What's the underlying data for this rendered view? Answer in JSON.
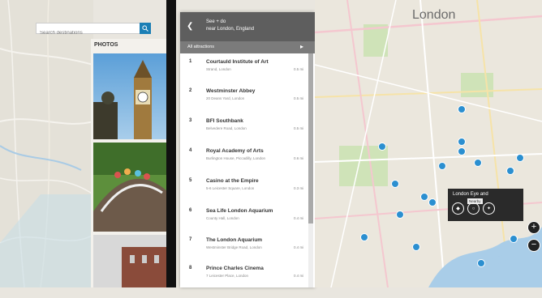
{
  "search": {
    "placeholder": "Search destinations"
  },
  "photos": {
    "label": "PHOTOS"
  },
  "panel": {
    "title": "See + do",
    "subtitle": "near London, England",
    "filter": "All attractions",
    "items": [
      {
        "num": "1",
        "name": "Courtauld Institute of Art",
        "addr": "Strand, London",
        "dist": "0.5 mi"
      },
      {
        "num": "2",
        "name": "Westminster Abbey",
        "addr": "20 Deans Yard, London",
        "dist": "0.5 mi"
      },
      {
        "num": "3",
        "name": "BFI Southbank",
        "addr": "Belvedere Road, London",
        "dist": "0.5 mi"
      },
      {
        "num": "4",
        "name": "Royal Academy of Arts",
        "addr": "Burlington House, Piccadilly, London",
        "dist": "0.6 mi"
      },
      {
        "num": "5",
        "name": "Casino at the Empire",
        "addr": "5-6 Leicester Square, London",
        "dist": "0.3 mi"
      },
      {
        "num": "6",
        "name": "Sea Life London Aquarium",
        "addr": "County Hall, London",
        "dist": "0.4 mi"
      },
      {
        "num": "7",
        "name": "The London Aquarium",
        "addr": "Westminster Bridge Road, London",
        "dist": "0.4 mi"
      },
      {
        "num": "8",
        "name": "Prince Charles Cinema",
        "addr": "7 Leicester Place, London",
        "dist": "0.4 mi"
      }
    ]
  },
  "map": {
    "city": "London",
    "popup": {
      "title": "London Eye and",
      "tooltip": "Nearby"
    }
  },
  "colors": {
    "accent": "#1b7fb5",
    "pin": "#2b8fd0",
    "header": "#5e5e5e"
  }
}
